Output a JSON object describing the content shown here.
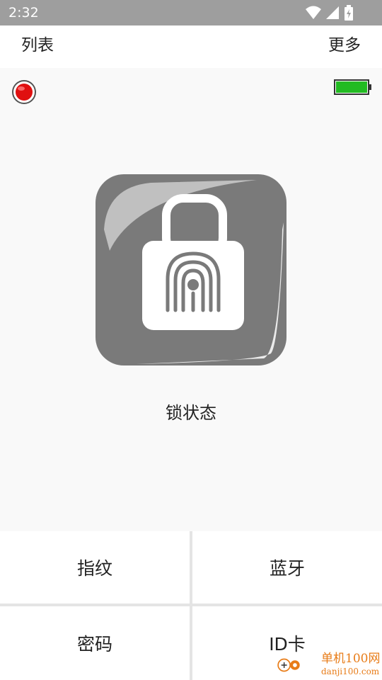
{
  "status_bar": {
    "time": "2:32"
  },
  "top_bar": {
    "left_label": "列表",
    "right_label": "更多"
  },
  "lock": {
    "status_label": "锁状态"
  },
  "actions": [
    {
      "label": "指纹"
    },
    {
      "label": "蓝牙"
    },
    {
      "label": "密码"
    },
    {
      "label": "ID卡"
    }
  ],
  "watermark": {
    "line1": "单机100网",
    "line2": "danji100.com"
  },
  "colors": {
    "status_bar_bg": "#9e9e9e",
    "lock_tile": "#7a7a7a",
    "battery_fill": "#22bb22",
    "indicator_red": "#e01010",
    "watermark": "#e87c18"
  }
}
